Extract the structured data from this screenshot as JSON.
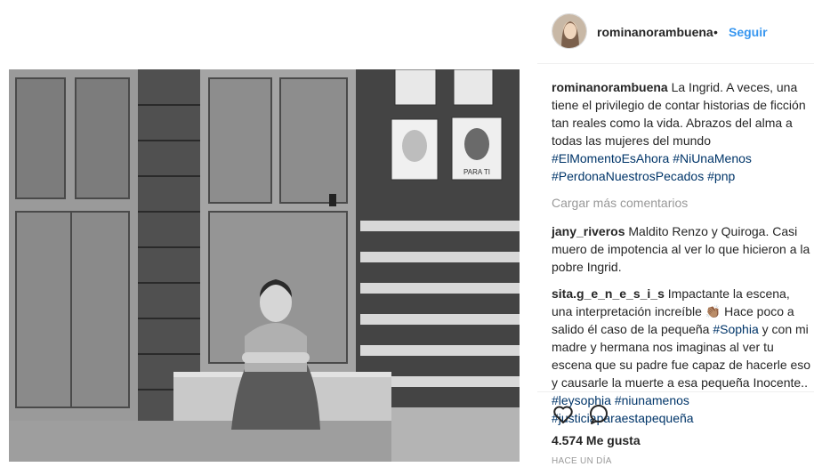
{
  "post": {
    "username": "rominanorambuena",
    "separator": "•",
    "follow_label": "Seguir"
  },
  "caption": {
    "username": "rominanorambuena",
    "text": "La Ingrid. A veces, una tiene el privilegio de contar historias de ficción tan reales como la vida. Abrazos del alma a todas las mujeres del mundo",
    "hashtags": [
      "#ElMomentoEsAhora",
      "#NiUnaMenos",
      "#PerdonaNuestrosPecados",
      "#pnp"
    ]
  },
  "load_more": "Cargar más comentarios",
  "comments": [
    {
      "username": "jany_riveros",
      "text": "Maldito Renzo y Quiroga. Casi muero de impotencia al ver lo que hicieron a la pobre Ingrid."
    },
    {
      "username": "sita.g_e_n_e_s_i_s",
      "text_1": "Impactante la escena, una interpretación increíble",
      "emoji": "👏🏽",
      "text_2": "Hace poco a salido él caso de la pequeña",
      "tag_1": "#Sophia",
      "text_3": "y con mi madre y hermana nos imaginas al ver tu escena que su padre fue capaz de hacerle eso y causarle la muerte a esa pequeña Inocente..",
      "tag_2": "#leysophia",
      "tag_3": "#niunamenos",
      "tag_4": "#justiciaparaestapequeña"
    }
  ],
  "likes": "4.574 Me gusta",
  "timestamp": "HACE UN DÍA",
  "icons": {
    "like": "heart-icon",
    "comment": "comment-bubble-icon"
  },
  "photo_sign_text": "PARA TI"
}
